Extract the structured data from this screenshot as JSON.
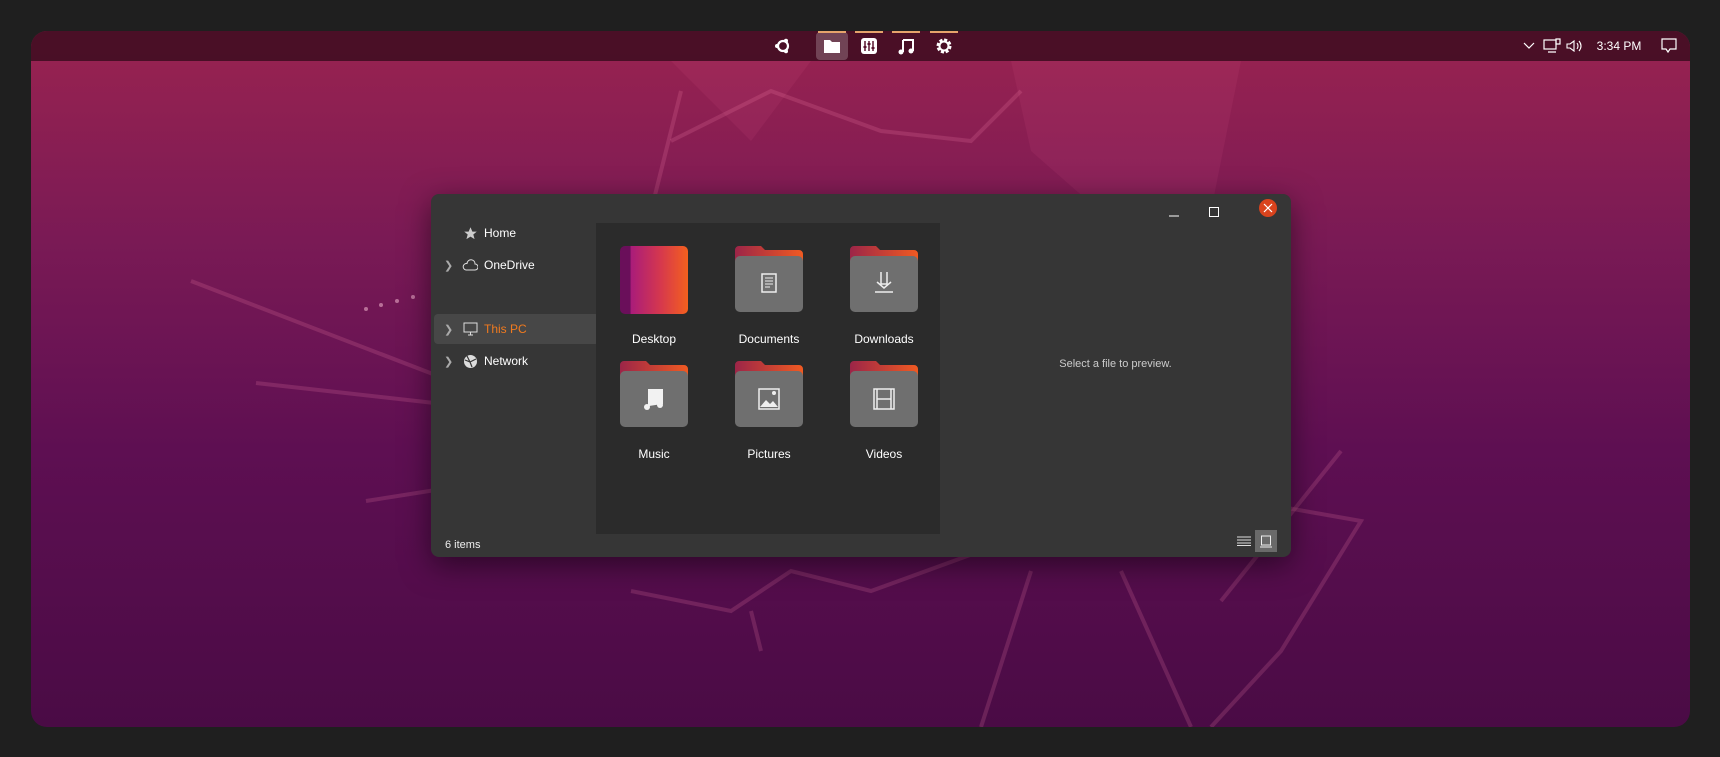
{
  "taskbar": {
    "apps": [
      {
        "name": "ubuntu-logo",
        "active": false
      },
      {
        "name": "files",
        "active": true
      },
      {
        "name": "mixer",
        "active": false
      },
      {
        "name": "music",
        "active": false
      },
      {
        "name": "settings",
        "active": false
      }
    ],
    "clock": "3:34 PM"
  },
  "sidebar": {
    "items": [
      {
        "label": "Home",
        "icon": "star-icon"
      },
      {
        "label": "OneDrive",
        "icon": "cloud-icon"
      },
      {
        "label": "This PC",
        "icon": "monitor-icon",
        "selected": true
      },
      {
        "label": "Network",
        "icon": "network-icon"
      }
    ]
  },
  "folders": [
    {
      "label": "Desktop"
    },
    {
      "label": "Documents"
    },
    {
      "label": "Downloads"
    },
    {
      "label": "Music"
    },
    {
      "label": "Pictures"
    },
    {
      "label": "Videos"
    }
  ],
  "preview": {
    "text": "Select a file to preview."
  },
  "status": {
    "count": "6 items"
  },
  "colors": {
    "accent": "#f07a1f",
    "close": "#d9431d",
    "wall_top": "#9a2350",
    "wall_bottom": "#4a0b45"
  }
}
